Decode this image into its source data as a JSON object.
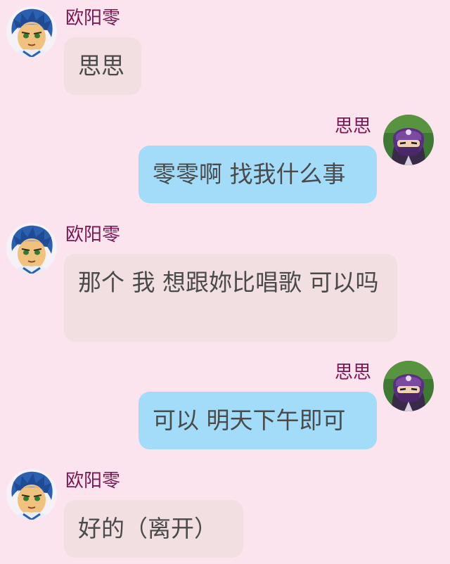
{
  "chat": {
    "messages": [
      {
        "sender": "欧阳零",
        "side": "left",
        "text": "思思",
        "avatar": "blue-haired-boy-avatar"
      },
      {
        "sender": "思思",
        "side": "right",
        "text": "零零啊 找我什么事",
        "avatar": "masked-ninja-avatar"
      },
      {
        "sender": "欧阳零",
        "side": "left",
        "text": "那个 我 想跟妳比唱歌 可以吗",
        "avatar": "blue-haired-boy-avatar"
      },
      {
        "sender": "思思",
        "side": "right",
        "text": "可以 明天下午即可",
        "avatar": "masked-ninja-avatar"
      },
      {
        "sender": "欧阳零",
        "side": "left",
        "text": "好的（离开）",
        "avatar": "blue-haired-boy-avatar"
      }
    ]
  },
  "colors": {
    "background": "#fbe4ee",
    "left_bubble": "#f2dfe2",
    "right_bubble": "#a3dcf9",
    "name_text": "#7a1650",
    "message_text": "#4a4a4a"
  }
}
